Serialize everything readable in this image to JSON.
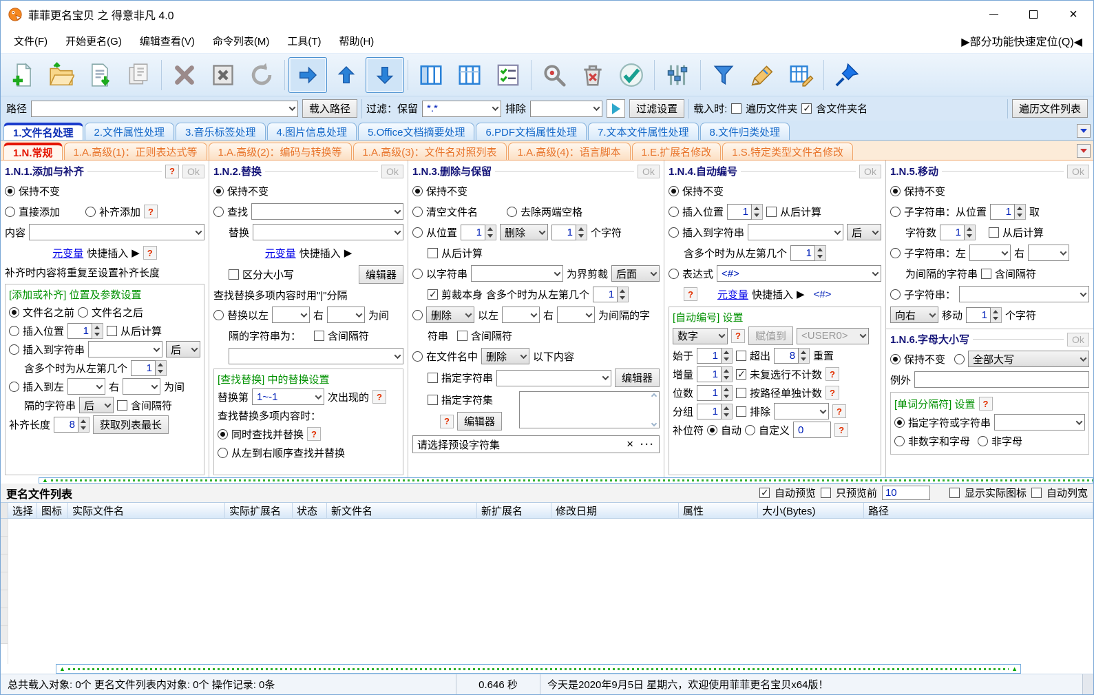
{
  "window": {
    "title": "菲菲更名宝贝 之 得意非凡 4.0"
  },
  "colors": {
    "accent_blue": "#1a3ccc",
    "tab_orange": "#e8742a",
    "active_red": "#e41400",
    "link_blue": "#0000e8",
    "group_green": "#009100",
    "help_red": "#e23000",
    "value_navy": "#0020b8"
  },
  "menubar": {
    "items": [
      "文件(F)",
      "开始更名(G)",
      "编辑查看(V)",
      "命令列表(M)",
      "工具(T)",
      "帮助(H)"
    ],
    "quick_locate": "▶部分功能快速定位(Q)◀"
  },
  "toolbar": {
    "icons": [
      "new-file",
      "open-folder",
      "import-list",
      "save-list",
      "delete",
      "delete-all",
      "refresh",
      "move-right",
      "move-up",
      "move-down",
      "view-columns-left",
      "view-columns",
      "checklist",
      "search",
      "clear-trash",
      "apply-check",
      "adjust-sliders",
      "filter-funnel",
      "rename-edit",
      "edit-table",
      "pin"
    ]
  },
  "pathbar": {
    "path_label": "路径",
    "path_value": "",
    "load_path_button": "载入路径",
    "filter_label": "过滤：保留",
    "filter_value": "*.*",
    "exclude_label": "排除",
    "exclude_value": "",
    "filter_settings_button": "过滤设置",
    "load_when_label": "载入时:",
    "traverse_folders": "遍历文件夹",
    "include_folder_names": "含文件夹名",
    "traverse_list_button": "遍历文件列表"
  },
  "main_tabs": [
    "1.文件名处理",
    "2.文件属性处理",
    "3.音乐标签处理",
    "4.图片信息处理",
    "5.Office文档摘要处理",
    "6.PDF文档属性处理",
    "7.文本文件属性处理",
    "8.文件归类处理"
  ],
  "sub_tabs": [
    "1.N.常规",
    "1.A.高级(1)：正则表达式等",
    "1.A.高级(2)：编码与转换等",
    "1.A.高级(3)：文件名对照列表",
    "1.A.高级(4)：语言脚本",
    "1.E.扩展名修改",
    "1.S.特定类型文件名修改"
  ],
  "common": {
    "ok": "Ok",
    "help": "?",
    "keep": "保持不变",
    "metavar": "元变量",
    "quick_insert": "快捷插入",
    "arrow": "▶",
    "editor": "编辑器",
    "from_end": "从后计算",
    "incl_sep": "含间隔符",
    "right": "右",
    "after": "后",
    "nth_from_left": "含多个时为从左第几个",
    "one": "1",
    "eight": "8"
  },
  "panel_add": {
    "title": "1.N.1.添加与补齐",
    "direct_add": "直接添加",
    "pad_add": "补齐添加",
    "content_label": "内容",
    "pad_note": "补齐时内容将重复至设置补齐长度",
    "group_title": "[添加或补齐] 位置及参数设置",
    "before_name": "文件名之前",
    "after_name": "文件名之后",
    "insert_pos": "插入位置",
    "insert_to_string": "插入到字符串",
    "insert_between": "插入到左",
    "as_sep_tail": "为间",
    "sep_string_2": "隔的字符串",
    "pad_length": "补齐长度",
    "get_longest_button": "获取列表最长"
  },
  "panel_replace": {
    "title": "1.N.2.替换",
    "find": "查找",
    "replace": "替换",
    "case_sensitive": "区分大小写",
    "multi_note": "查找替换多项内容时用\"|\"分隔",
    "replace_between": "替换以左",
    "as_sep_tail": "为间",
    "sep_label": "隔的字符串为：",
    "group_title": "[查找替换] 中的替换设置",
    "replace_nth": "替换第",
    "nth_value": "1~-1",
    "nth_tail": "次出现的",
    "multi_when": "查找替换多项内容时：",
    "simultaneous": "同时查找并替换",
    "sequential": "从左到右顺序查找并替换"
  },
  "panel_delete": {
    "title": "1.N.3.删除与保留",
    "clear_name": "清空文件名",
    "trim_spaces": "去除两端空格",
    "from_pos": "从位置",
    "delete_word": "删除",
    "chars_tail": "个字符",
    "by_string": "以字符串",
    "cut_bound": "为界剪裁",
    "back_word": "后面",
    "cut_self": "剪裁本身",
    "between_left": "以左",
    "sep_tail": "为间隔的字",
    "sep_tail2": "符串",
    "in_name": "在文件名中",
    "following": "以下内容",
    "spec_string": "指定字符串",
    "spec_charset": "指定字符集",
    "preset_placeholder": "请选择预设字符集",
    "close_x": "×",
    "more": "···"
  },
  "panel_number": {
    "title": "1.N.4.自动编号",
    "insert_pos": "插入位置",
    "insert_to_string": "插入到字符串",
    "expression": "表达式",
    "expr_value": "<#>",
    "expr_tag": "<#>",
    "group_title": "[自动编号] 设置",
    "type_word": "数字",
    "assign_to": "赋值到",
    "assign_target": "<USER0>",
    "start_at": "始于",
    "exceed": "超出",
    "reset": "重置",
    "increment": "增量",
    "skip_unchecked": "未复选行不计数",
    "digits": "位数",
    "per_path": "按路径单独计数",
    "group_word": "分组",
    "exclude": "排除",
    "pad_char": "补位符",
    "auto": "自动",
    "custom": "自定义",
    "custom_value": "0"
  },
  "panel_move": {
    "title": "1.N.5.移动",
    "substr_pos": "子字符串：从位置",
    "take": "取",
    "char_count": "字符数",
    "substr_between": "子字符串：左",
    "sep_line": "为间隔的字符串",
    "substr": "子字符串：",
    "direction": "向右",
    "move": "移动",
    "chars_tail": "个字符"
  },
  "panel_case": {
    "title": "1.N.6.字母大小写",
    "mode_value": "全部大写",
    "exception": "例外",
    "group_title": "[单词分隔符] 设置",
    "spec_chars": "指定字符或字符串",
    "non_alnum": "非数字和字母",
    "non_alpha": "非字母"
  },
  "file_list": {
    "title": "更名文件列表",
    "auto_preview": "自动预览",
    "preview_first": "只预览前",
    "preview_count": "10",
    "show_icons": "显示实际图标",
    "auto_width": "自动列宽"
  },
  "table": {
    "headers": [
      "选择",
      "图标",
      "实际文件名",
      "实际扩展名",
      "状态",
      "新文件名",
      "新扩展名",
      "修改日期",
      "属性",
      "大小(Bytes)",
      "路径"
    ]
  },
  "statusbar": {
    "totals": "总共载入对象: 0个  更名文件列表内对象: 0个  操作记录: 0条",
    "time": "0.646 秒",
    "greeting": "今天是2020年9月5日 星期六，欢迎使用菲菲更名宝贝x64版！"
  }
}
